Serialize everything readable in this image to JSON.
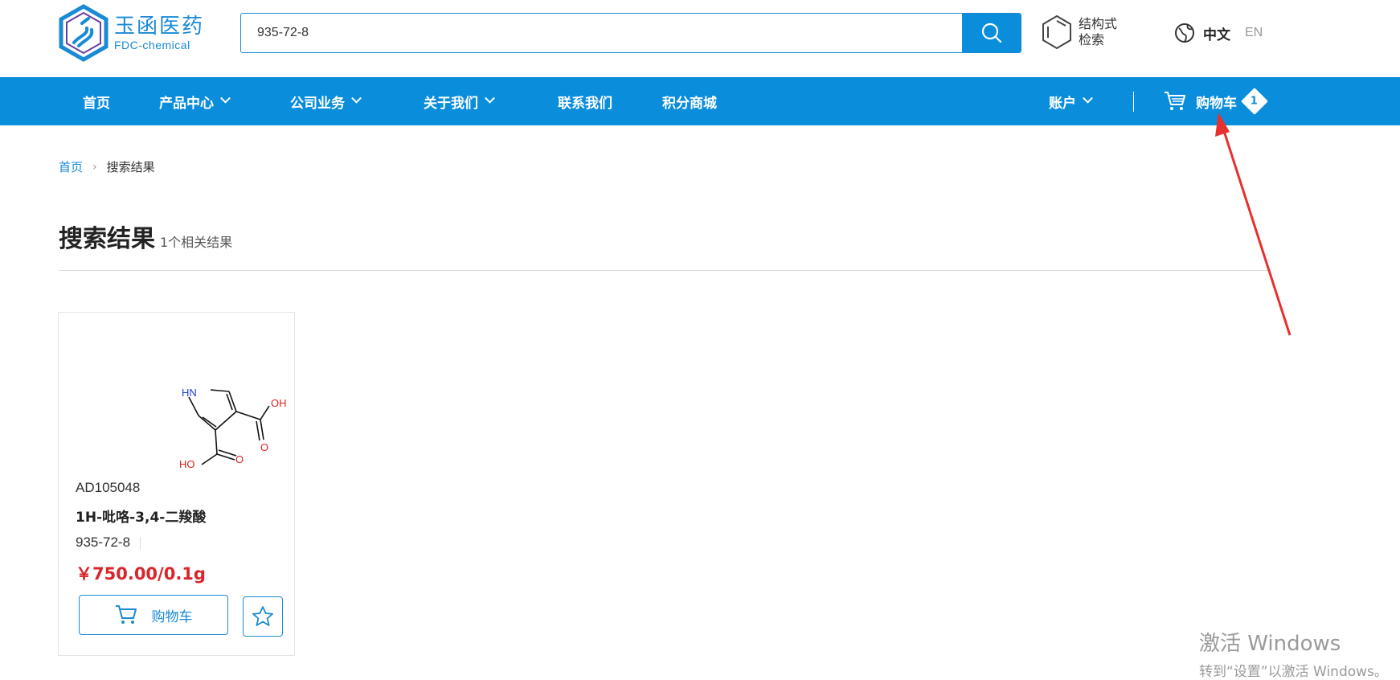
{
  "header": {
    "logo_cn": "玉函医药",
    "logo_en": "FDC-chemical",
    "search_value": "935-72-8",
    "structure_search_line1": "结构式",
    "structure_search_line2": "检索",
    "lang_zh": "中文",
    "lang_en": "EN"
  },
  "nav": {
    "items": [
      "首页",
      "产品中心",
      "公司业务",
      "关于我们",
      "联系我们",
      "积分商城"
    ],
    "account": "账户",
    "cart": "购物车",
    "cart_count": "1"
  },
  "breadcrumb": {
    "home": "首页",
    "current": "搜索结果"
  },
  "results": {
    "title": "搜索结果",
    "count_text": "1个相关结果"
  },
  "product": {
    "code": "AD105048",
    "name": "1H-吡咯-3,4-二羧酸",
    "cas": "935-72-8",
    "price": "￥750.00/0.1g",
    "cart_button": "购物车",
    "structure_labels": {
      "nh": "HN",
      "oh_top": "OH",
      "o_top": "O",
      "ho_bottom": "HO",
      "o_bottom": "O"
    }
  },
  "watermark": {
    "line1": "激活 Windows",
    "line2": "转到“设置”以激活 Windows。"
  },
  "colors": {
    "brand_blue": "#0a8ddb",
    "price_red": "#d9262a",
    "annotation_red": "#e8302e"
  }
}
